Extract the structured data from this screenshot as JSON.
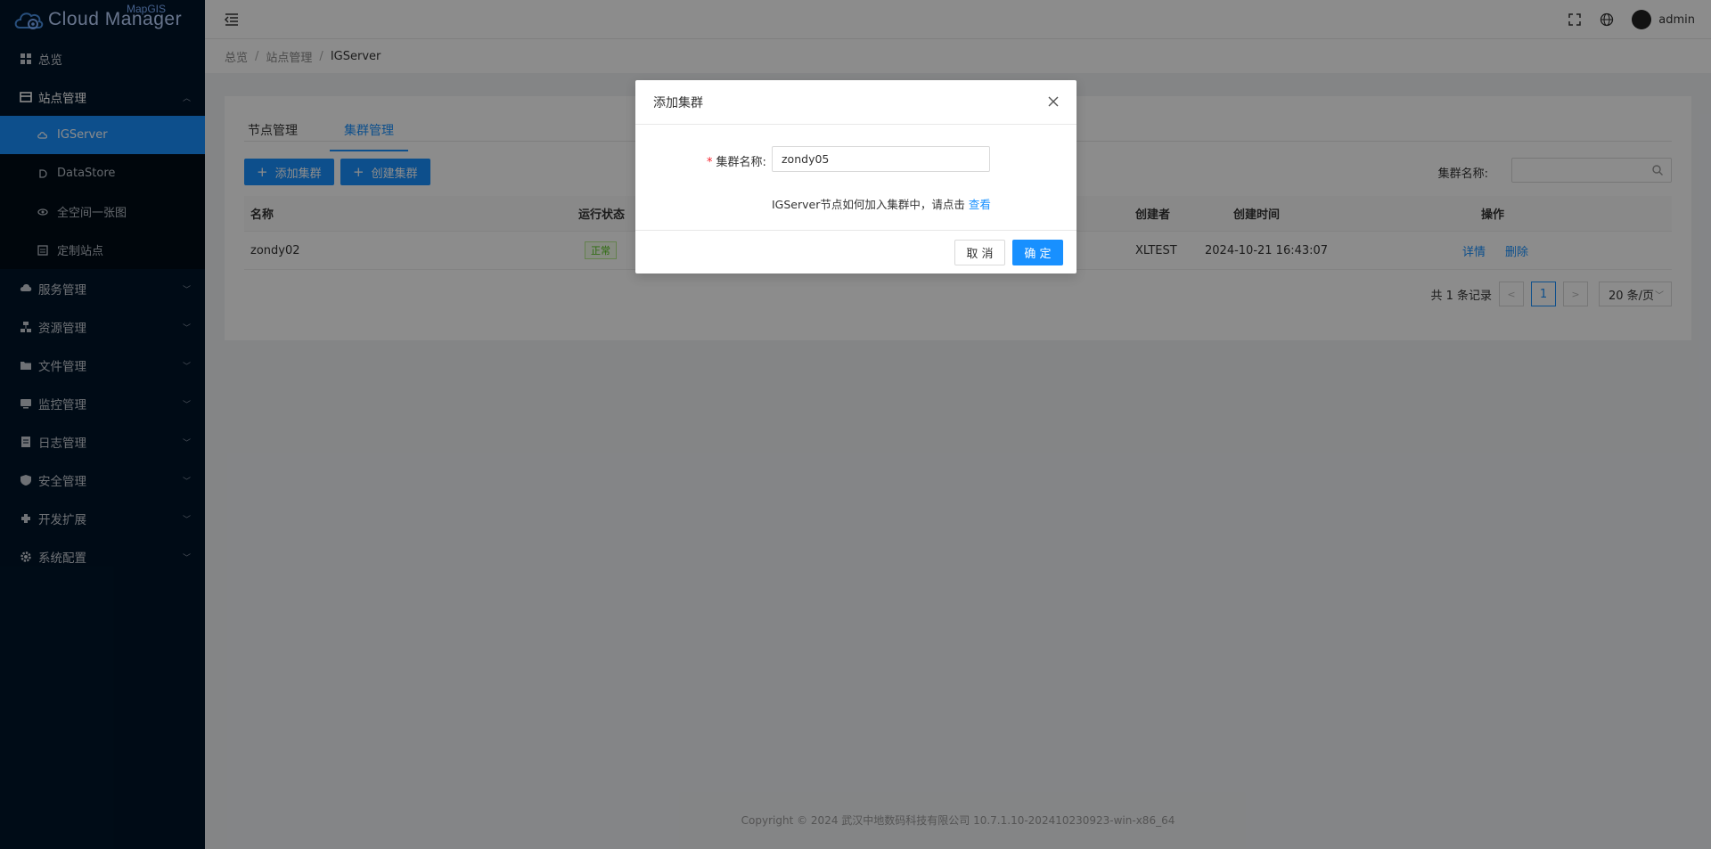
{
  "app": {
    "logo_text": "Cloud Manager",
    "logo_sub": "MapGIS"
  },
  "sidebar": {
    "items": [
      {
        "label": "总览",
        "icon": "grid-icon"
      },
      {
        "label": "站点管理",
        "icon": "site-icon",
        "expanded": true,
        "children": [
          {
            "label": "IGServer",
            "icon": "cloud-icon",
            "active": true
          },
          {
            "label": "DataStore",
            "icon": "datastore-icon"
          },
          {
            "label": "全空间一张图",
            "icon": "globe-icon"
          },
          {
            "label": "定制站点",
            "icon": "custom-site-icon"
          }
        ]
      },
      {
        "label": "服务管理",
        "icon": "service-icon"
      },
      {
        "label": "资源管理",
        "icon": "resource-icon"
      },
      {
        "label": "文件管理",
        "icon": "folder-icon"
      },
      {
        "label": "监控管理",
        "icon": "monitor-icon"
      },
      {
        "label": "日志管理",
        "icon": "log-icon"
      },
      {
        "label": "安全管理",
        "icon": "shield-icon"
      },
      {
        "label": "开发扩展",
        "icon": "extension-icon"
      },
      {
        "label": "系统配置",
        "icon": "gear-icon"
      }
    ]
  },
  "header": {
    "user_name": "admin"
  },
  "breadcrumb": [
    "总览",
    "站点管理",
    "IGServer"
  ],
  "tabs": [
    {
      "label": "节点管理",
      "active": false
    },
    {
      "label": "集群管理",
      "active": true
    }
  ],
  "toolbar": {
    "add_cluster": "添加集群",
    "create_cluster": "创建集群",
    "search_label": "集群名称:"
  },
  "table": {
    "headers": {
      "name": "名称",
      "status": "运行状态",
      "creator": "创建者",
      "created_at": "创建时间",
      "actions": "操作"
    },
    "rows": [
      {
        "name": "zondy02",
        "status": "正常",
        "creator": "XLTEST",
        "created_at": "2024-10-21 16:43:07",
        "action_detail": "详情",
        "action_delete": "删除"
      }
    ]
  },
  "pagination": {
    "total_text": "共 1 条记录",
    "current_page": "1",
    "page_size": "20 条/页"
  },
  "footer": {
    "copyright": "Copyright © 2024 武汉中地数码科技有限公司 10.7.1.10-202410230923-win-x86_64"
  },
  "modal": {
    "title": "添加集群",
    "field_label": "集群名称:",
    "field_required_mark": "*",
    "field_value": "zondy05",
    "hint_text": "IGServer节点如何加入集群中，请点击",
    "hint_link": "查看",
    "cancel_label": "取 消",
    "ok_label": "确 定"
  },
  "colors": {
    "sidebar_bg": "#001529",
    "primary": "#1890ff",
    "success": "#52c41a",
    "required": "#f5222d"
  }
}
